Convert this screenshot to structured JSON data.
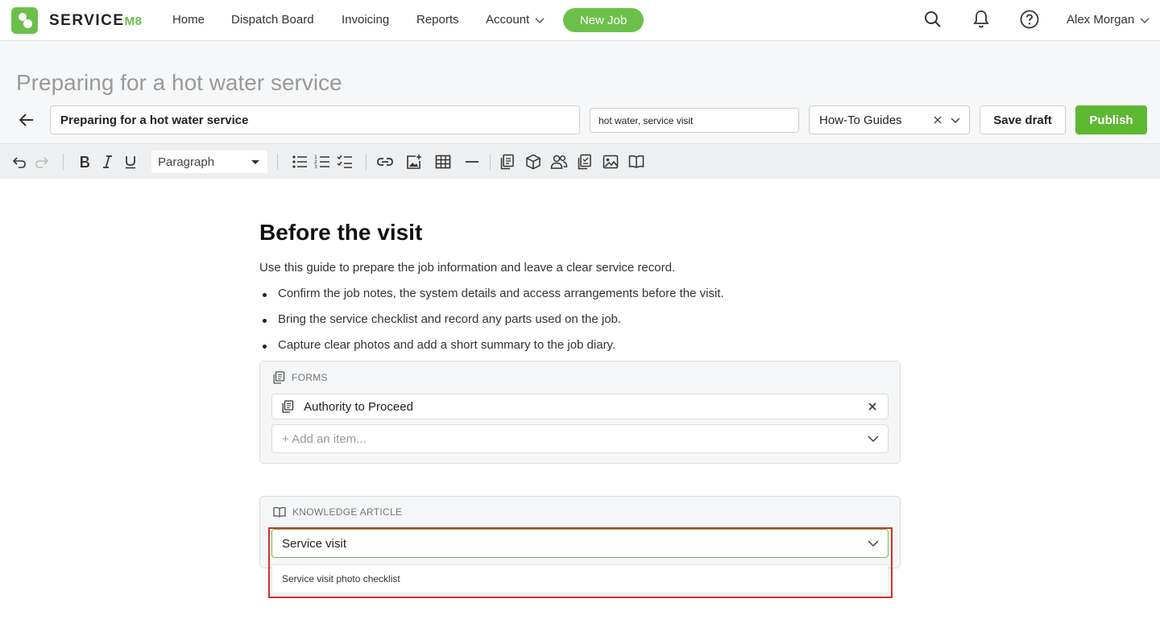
{
  "app": {
    "brand_main": "Service",
    "brand_suffix": "M8"
  },
  "nav": {
    "home": "Home",
    "dispatch_board": "Dispatch Board",
    "invoicing": "Invoicing",
    "reports": "Reports",
    "account": "Account",
    "new_job": "New Job",
    "user_name": "Alex Morgan"
  },
  "editor": {
    "page_title": "Preparing for a hot water service",
    "title_value": "Preparing for a hot water service",
    "tags_value": "hot water, service visit",
    "category_value": "How-To Guides",
    "save_draft_label": "Save draft",
    "publish_label": "Publish"
  },
  "toolbar": {
    "block_format": "Paragraph"
  },
  "article": {
    "heading": "Before the visit",
    "intro": "Use this guide to prepare the job information and leave a clear service record.",
    "bullets": [
      "Confirm the job notes, the system details and access arrangements before the visit.",
      "Bring the service checklist and record any parts used on the job.",
      "Capture clear photos and add a short summary to the job diary."
    ],
    "forms_block": {
      "heading": "FORMS",
      "items": [
        {
          "label": "Authority to Proceed"
        }
      ],
      "add_placeholder": "+ Add an item..."
    },
    "knowledge_block": {
      "heading": "KNOWLEDGE ARTICLE",
      "search_value": "Service visit",
      "suggestions": [
        "Service visit photo checklist"
      ]
    }
  },
  "colors": {
    "brand_green": "#6cc04a",
    "publish_green": "#5eb833",
    "highlight_red": "#d32f2f"
  }
}
